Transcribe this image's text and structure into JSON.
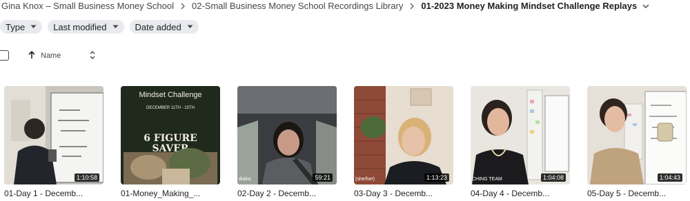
{
  "breadcrumb": {
    "items": [
      "Gina Knox – Small Business Money School",
      "02-Small Business Money School Recordings Library",
      "01-2023 Money Making Mindset Challenge Replays"
    ]
  },
  "filters": [
    {
      "label": "Type"
    },
    {
      "label": "Last modified"
    },
    {
      "label": "Date added"
    }
  ],
  "list_header": {
    "name_label": "Name"
  },
  "files": [
    {
      "title": "01-Day 1 - Decemb...",
      "duration": "1:10:58",
      "thumbnail": "man-at-whiteboard"
    },
    {
      "title": "01-Money_Making_...",
      "duration": "",
      "thumbnail": "mindset-challenge-poster",
      "poster": {
        "heading": "Mindset Challenge",
        "dates": "DECEMBER 11TH - 15TH",
        "line1": "6 FIGURE",
        "line2": "SAVER"
      }
    },
    {
      "title": "02-Day 2 - Decemb...",
      "duration": "59:21",
      "thumbnail": "woman-in-car",
      "overlay_label": "dialnc"
    },
    {
      "title": "03-Day 3 - Decemb...",
      "duration": "1:13:23",
      "thumbnail": "woman-speaking",
      "overlay_label": "(she/her)"
    },
    {
      "title": "04-Day 4 - Decemb...",
      "duration": "1:04:08",
      "thumbnail": "woman-at-whiteboard",
      "overlay_label": "CHING TEAM"
    },
    {
      "title": "05-Day 5 - Decemb...",
      "duration": "1:04:43",
      "thumbnail": "woman-with-mug"
    }
  ],
  "colors": {
    "chip_bg": "#e8eaed",
    "poster_bg": "#1f2a1c",
    "poster_text": "#f3efe3"
  }
}
